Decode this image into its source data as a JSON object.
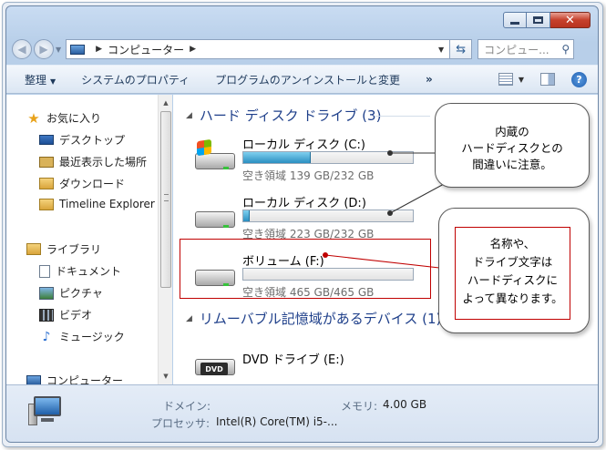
{
  "window": {
    "address_crumb": "コンピューター",
    "search_placeholder": "コンピュー...",
    "refresh_icon": "refresh-icon"
  },
  "toolbar": {
    "organize": "整理",
    "properties": "システムのプロパティ",
    "uninstall": "プログラムのアンインストールと変更",
    "more": "»"
  },
  "sidebar": {
    "favorites": "お気に入り",
    "desktop": "デスクトップ",
    "recent": "最近表示した場所",
    "downloads": "ダウンロード",
    "timeline": "Timeline Explorer",
    "libraries": "ライブラリ",
    "documents": "ドキュメント",
    "pictures": "ピクチャ",
    "videos": "ビデオ",
    "music": "ミュージック",
    "computer": "コンピューター"
  },
  "groups": {
    "hdd": "ハード ディスク ドライブ (3)",
    "removable": "リムーバブル記憶域があるデバイス (1)"
  },
  "drives": [
    {
      "name": "ローカル ディスク (C:)",
      "free": "空き領域 139 GB/232 GB",
      "used_fraction": 0.4
    },
    {
      "name": "ローカル ディスク (D:)",
      "free": "空き領域 223 GB/232 GB",
      "used_fraction": 0.04
    },
    {
      "name": "ボリューム (F:)",
      "free": "空き領域 465 GB/465 GB",
      "used_fraction": 0.0
    },
    {
      "name": "DVD ドライブ (E:)",
      "badge": "DVD"
    }
  ],
  "callouts": {
    "first": [
      "内蔵の",
      "ハードディスクとの",
      "間違いに注意。"
    ],
    "second": [
      "名称や、",
      "ドライブ文字は",
      "ハードディスクに",
      "よって異なります。"
    ]
  },
  "details": {
    "domain_label": "ドメイン:",
    "memory_label": "メモリ:",
    "memory_value": "4.00 GB",
    "cpu_label": "プロセッサ:",
    "cpu_value": "Intel(R) Core(TM) i5-..."
  },
  "colors": {
    "accent_red": "#c00000",
    "group_heading": "#1e3f8a",
    "drive_fill": "#2a8fc1"
  }
}
